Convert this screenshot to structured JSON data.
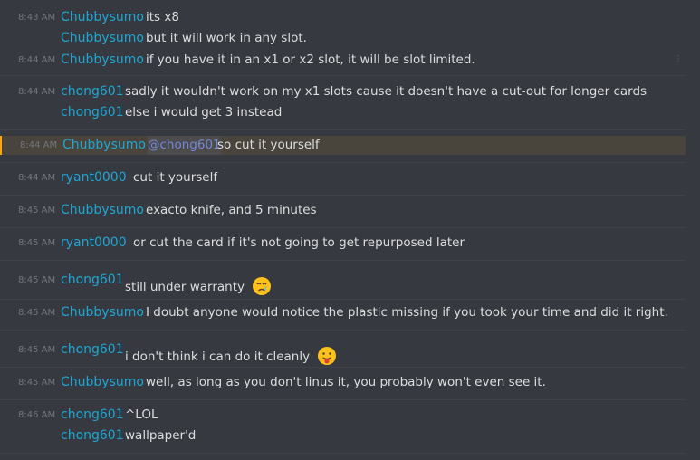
{
  "messages": [
    {
      "time": "8:43 AM",
      "author": "Chubbysumo",
      "text": "its x8"
    },
    {
      "time": "",
      "author": "Chubbysumo",
      "text": "but it will work in any slot."
    },
    {
      "time": "8:44 AM",
      "author": "Chubbysumo",
      "text": "if you have it in an x1 or x2 slot, it will be slot limited."
    },
    {
      "time": "8:44 AM",
      "author": "chong601",
      "text": "sadly it wouldn't work on my x1 slots cause it doesn't have a cut-out for longer cards"
    },
    {
      "time": "",
      "author": "chong601",
      "text": "else i would get 3 instead"
    },
    {
      "time": "8:44 AM",
      "author": "Chubbysumo",
      "mention": "@chong601",
      "text": "so cut it yourself"
    },
    {
      "time": "8:44 AM",
      "author": "ryant0000",
      "text": "cut it yourself"
    },
    {
      "time": "8:45 AM",
      "author": "Chubbysumo",
      "text": "exacto knife, and 5 minutes"
    },
    {
      "time": "8:45 AM",
      "author": "ryant0000",
      "text": "or cut the card if it's not going to get repurposed later"
    },
    {
      "time": "8:45 AM",
      "author": "chong601",
      "text": "still under warranty",
      "emoji": "crying-face-emoji"
    },
    {
      "time": "8:45 AM",
      "author": "Chubbysumo",
      "text": "I doubt anyone would notice the plastic missing if you took your time and did it right."
    },
    {
      "time": "8:45 AM",
      "author": "chong601",
      "text": "i don't think i can do it cleanly",
      "emoji": "tongue-out-face-emoji"
    },
    {
      "time": "8:45 AM",
      "author": "Chubbysumo",
      "text": "well, as long as you don't linus it, you probably won't even see it."
    },
    {
      "time": "8:46 AM",
      "author": "chong601",
      "text": "^LOL"
    },
    {
      "time": "",
      "author": "chong601",
      "text": "wallpaper'd"
    }
  ],
  "colors": {
    "background": "#36393f",
    "author": "#1fa6d3",
    "timestamp": "#72767d",
    "text": "#dcddde",
    "mention": "#7289da",
    "highlight": "#49443c"
  }
}
